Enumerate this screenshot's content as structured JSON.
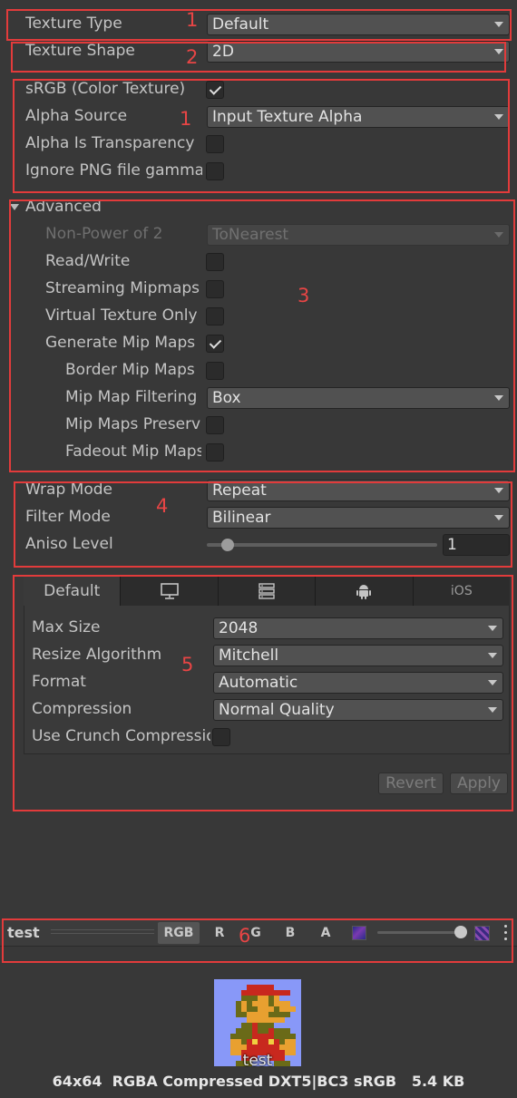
{
  "texture_type": {
    "label": "Texture Type",
    "value": "Default"
  },
  "texture_shape": {
    "label": "Texture Shape",
    "value": "2D"
  },
  "srgb": {
    "label": "sRGB (Color Texture)",
    "checked": true
  },
  "alpha_source": {
    "label": "Alpha Source",
    "value": "Input Texture Alpha"
  },
  "alpha_is_transparency": {
    "label": "Alpha Is Transparency",
    "checked": false
  },
  "ignore_png_gamma": {
    "label": "Ignore PNG file gamma",
    "checked": false
  },
  "advanced": {
    "label": "Advanced",
    "non_power_of_2": {
      "label": "Non-Power of 2",
      "value": "ToNearest"
    },
    "read_write": {
      "label": "Read/Write",
      "checked": false
    },
    "streaming_mipmaps": {
      "label": "Streaming Mipmaps",
      "checked": false
    },
    "virtual_texture_only": {
      "label": "Virtual Texture Only",
      "checked": false
    },
    "generate_mip_maps": {
      "label": "Generate Mip Maps",
      "checked": true
    },
    "border_mip_maps": {
      "label": "Border Mip Maps",
      "checked": false
    },
    "mip_map_filtering": {
      "label": "Mip Map Filtering",
      "value": "Box"
    },
    "mip_maps_preserve": {
      "label": "Mip Maps Preserve Coverage",
      "checked": false
    },
    "fadeout_mip_maps": {
      "label": "Fadeout Mip Maps",
      "checked": false
    }
  },
  "wrap_mode": {
    "label": "Wrap Mode",
    "value": "Repeat"
  },
  "filter_mode": {
    "label": "Filter Mode",
    "value": "Bilinear"
  },
  "aniso_level": {
    "label": "Aniso Level",
    "value": "1",
    "slider_fraction": 0.09
  },
  "platform_tabs": {
    "default": "Default",
    "standalone_icon": "monitor-icon",
    "server_icon": "server-icon",
    "android_icon": "android-icon",
    "ios": "iOS"
  },
  "platform": {
    "max_size": {
      "label": "Max Size",
      "value": "2048"
    },
    "resize_algorithm": {
      "label": "Resize Algorithm",
      "value": "Mitchell"
    },
    "format": {
      "label": "Format",
      "value": "Automatic"
    },
    "compression": {
      "label": "Compression",
      "value": "Normal Quality"
    },
    "use_crunch": {
      "label": "Use Crunch Compression",
      "checked": false
    }
  },
  "buttons": {
    "revert": "Revert",
    "apply": "Apply"
  },
  "preview": {
    "title": "test",
    "channels": [
      "RGB",
      "R",
      "G",
      "B",
      "A"
    ],
    "active_channel": "RGB",
    "mip_slider_fraction": 1.0,
    "image_caption": "test",
    "info": "64x64  RGBA Compressed DXT5|BC3 sRGB   5.4 KB"
  },
  "annotations": {
    "n1": "1",
    "n2": "2",
    "n1b": "1",
    "n3": "3",
    "n4": "4",
    "n5": "5",
    "n6": "6"
  },
  "colors": {
    "background": "#383838",
    "annotation_red": "#e23b3b",
    "field": "#515151",
    "text": "#c4c4c4"
  }
}
